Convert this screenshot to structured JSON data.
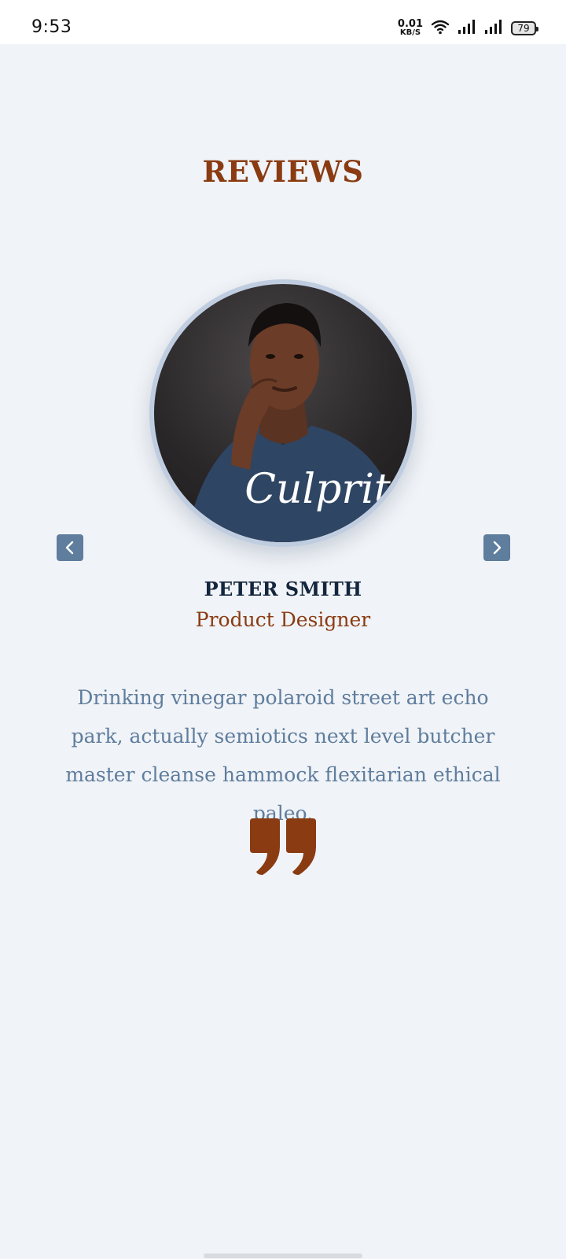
{
  "status": {
    "time": "9:53",
    "net_speed_value": "0.01",
    "net_speed_unit": "KB/S",
    "battery": "79",
    "icons": [
      "wifi-icon",
      "signal-icon",
      "signal-icon",
      "battery-icon"
    ]
  },
  "page": {
    "title": "REVIEWS"
  },
  "review": {
    "name": "PETER SMITH",
    "role": "Product Designer",
    "text": "Drinking vinegar polaroid street art echo park, actually semiotics next level butcher master cleanse hammock flexitarian ethical paleo.",
    "avatar_shirt_text": "Culprit"
  },
  "colors": {
    "accent": "#8a3b12",
    "name": "#14263d",
    "muted": "#5f7d9d",
    "background": "#f0f3f7",
    "nav_button": "#5f7d9d"
  }
}
